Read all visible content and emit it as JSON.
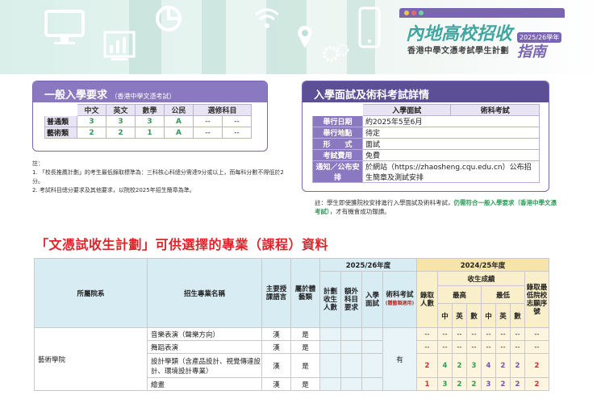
{
  "banner": {
    "icons": [
      "monitor-icon",
      "chart-icon",
      "pie-chart-icon",
      "wifi-icon",
      "location-pin-icon",
      "gear-icon",
      "phone-icon"
    ],
    "logo_title": "內地高校招收",
    "logo_year": "2025/26學年",
    "logo_subtitle": "香港中學文憑考試學生計劃",
    "logo_guide": "指南"
  },
  "general": {
    "title": "一般入學要求",
    "title_note": "（香港中學文憑考試）",
    "headers": [
      "",
      "中文",
      "英文",
      "數學",
      "公民",
      "選修科目"
    ],
    "rows": [
      {
        "label": "普通類",
        "cn": "3",
        "en": "3",
        "math": "3",
        "civic": "A",
        "el1": "--",
        "el2": "--"
      },
      {
        "label": "藝術類",
        "cn": "2",
        "en": "2",
        "math": "1",
        "civic": "A",
        "el1": "--",
        "el2": "--"
      }
    ],
    "notes_label": "註：",
    "notes": [
      "1. 「校長推薦計劃」的考生最低錄取標準為：三科核心科總分需達9分或以上，而每科分數不得低於2分。",
      "2. 考試科目總分要求及其他要求，以院校2025年招生簡章為準。"
    ]
  },
  "interview": {
    "title": "入學面試及術科考試詳情",
    "col_headers": [
      "",
      "入學面試",
      "術科考試"
    ],
    "rows": [
      {
        "k": "舉行日期",
        "v": "約2025年5至6月"
      },
      {
        "k": "舉行地點",
        "v": "待定"
      },
      {
        "k": "形　　式",
        "v": "面試"
      },
      {
        "k": "考試費用",
        "v": "免費"
      },
      {
        "k": "通知／公布安排",
        "v": "於網站（https://zhaosheng.cqu.edu.cn）公布招生簡章及測試安排"
      }
    ],
    "note_prefix": "註：學生即使獲院校安排進行入學面試及術科考試，",
    "note_highlight": "仍需符合一般入學要求（香港中學文憑考試）",
    "note_suffix": "，才有機會成功報讀。"
  },
  "section_title": "「文憑試收生計劃」可供選擇的專業（課程）資料",
  "program_table": {
    "col_school": "所屬院系",
    "col_program": "招生專業名稱",
    "col_language": "主要授課語言",
    "col_sports": "屬於體藝類",
    "year_current": "2025/26年度",
    "col_quota": "計劃收生人數",
    "col_extra": "額外科目要求",
    "col_interview": "入學面試",
    "col_art_exam": "術科考試",
    "col_art_exam_note": "(體藝類適用)",
    "year_previous": "2024/25年度",
    "col_admitted": "錄取人數",
    "col_results": "收生成績",
    "col_highest": "最高",
    "col_lowest": "最低",
    "col_order": "錄取最低院校志願序號",
    "subjects": [
      "中",
      "英",
      "數",
      "中",
      "英",
      "數"
    ],
    "school_name": "藝術學院",
    "art_exam_value": "有",
    "rows": [
      {
        "program": "音樂表演（聲樂方向）",
        "lang": "漢",
        "sports": "是",
        "admit": "--",
        "h": [
          "--",
          "--",
          "--"
        ],
        "l": [
          "--",
          "--",
          "--"
        ],
        "order": "--"
      },
      {
        "program": "舞蹈表演",
        "lang": "漢",
        "sports": "是",
        "admit": "--",
        "h": [
          "--",
          "--",
          "--"
        ],
        "l": [
          "--",
          "--",
          "--"
        ],
        "order": "--"
      },
      {
        "program": "設計學類（含產品設計、視覺傳達設計、環境設計專業）",
        "lang": "漢",
        "sports": "是",
        "admit": "2",
        "h": [
          "4",
          "2",
          "3"
        ],
        "l": [
          "4",
          "2",
          "2"
        ],
        "order": "2"
      },
      {
        "program": "繪畫",
        "lang": "漢",
        "sports": "是",
        "admit": "1",
        "h": [
          "3",
          "2",
          "2"
        ],
        "l": [
          "3",
          "2",
          "2"
        ],
        "order": "2"
      }
    ]
  },
  "colors": {
    "purple": "#8a78c0",
    "green": "#2d9a55",
    "red": "#e0242b",
    "blue_header": "#d8ecf4",
    "gold_header": "#f6e4a8"
  }
}
